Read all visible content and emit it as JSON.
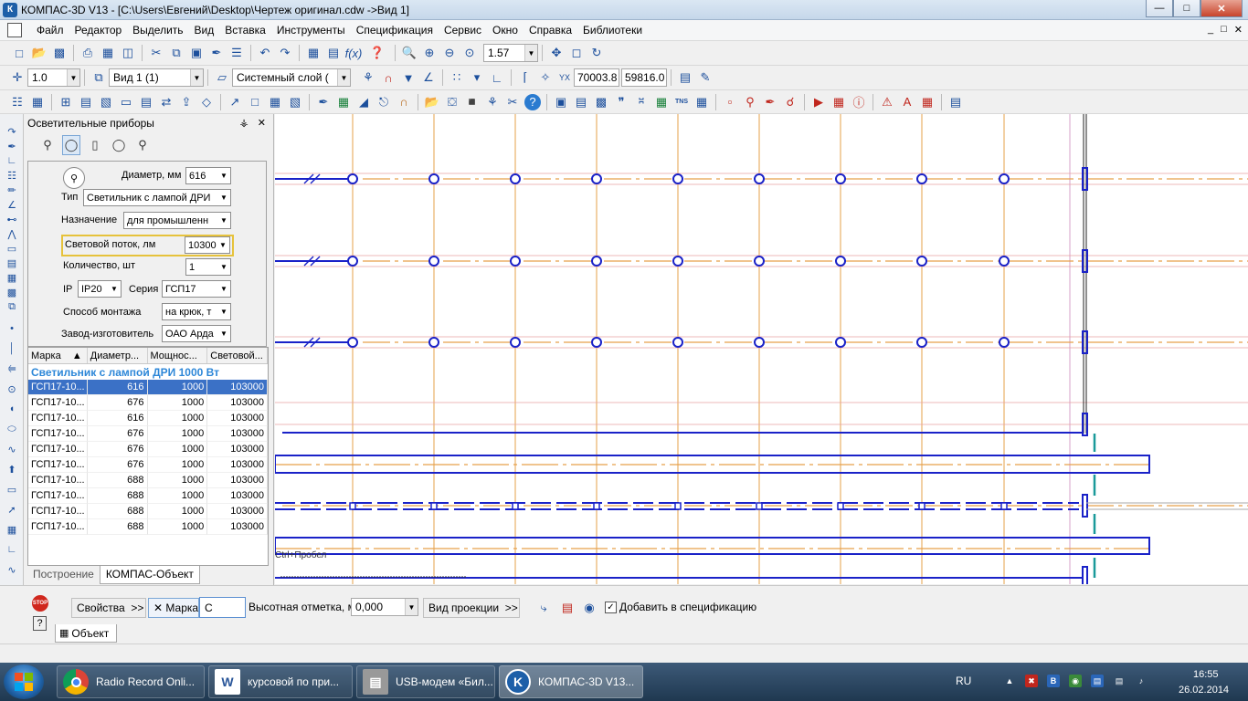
{
  "window": {
    "title": "КОМПАС-3D V13 - [C:\\Users\\Евгений\\Desktop\\Чертеж оригинал.cdw ->Вид 1]",
    "app_icon": "К"
  },
  "menu": [
    "Файл",
    "Редактор",
    "Выделить",
    "Вид",
    "Вставка",
    "Инструменты",
    "Спецификация",
    "Сервис",
    "Окно",
    "Справка",
    "Библиотеки"
  ],
  "toolbar1": {
    "zoom": "1.57"
  },
  "toolbar2": {
    "scale": "1.0",
    "view": "Вид 1 (1)",
    "layer": "Системный слой (",
    "coord_x": "70003.8",
    "coord_y": "59816.0"
  },
  "panel": {
    "title": "Осветительные приборы",
    "props": {
      "diameter_label": "Диаметр, мм",
      "diameter_value": "616",
      "type_label": "Тип",
      "type_value": "Светильник с лампой ДРИ",
      "purpose_label": "Назначение",
      "purpose_value": "для промышленн",
      "flux_label": "Световой поток, лм",
      "flux_value": "10300",
      "count_label": "Количество, шт",
      "count_value": "1",
      "ip_label": "IP",
      "ip_value": "IP20",
      "series_label": "Серия",
      "series_value": "ГСП17",
      "mount_label": "Способ монтажа",
      "mount_value": "на крюк, т",
      "maker_label": "Завод-изготовитель",
      "maker_value": "ОАО Арда"
    },
    "table": {
      "headers": [
        "Марка",
        "Диаметр...",
        "Мощнос...",
        "Световой..."
      ],
      "group": "Светильник с лампой ДРИ 1000 Вт",
      "rows": [
        {
          "mark": "ГСП17-10...",
          "diameter": "616",
          "power": "1000",
          "flux": "103000"
        },
        {
          "mark": "ГСП17-10...",
          "diameter": "676",
          "power": "1000",
          "flux": "103000"
        },
        {
          "mark": "ГСП17-10...",
          "diameter": "616",
          "power": "1000",
          "flux": "103000"
        },
        {
          "mark": "ГСП17-10...",
          "diameter": "676",
          "power": "1000",
          "flux": "103000"
        },
        {
          "mark": "ГСП17-10...",
          "diameter": "676",
          "power": "1000",
          "flux": "103000"
        },
        {
          "mark": "ГСП17-10...",
          "diameter": "676",
          "power": "1000",
          "flux": "103000"
        },
        {
          "mark": "ГСП17-10...",
          "diameter": "688",
          "power": "1000",
          "flux": "103000"
        },
        {
          "mark": "ГСП17-10...",
          "diameter": "688",
          "power": "1000",
          "flux": "103000"
        },
        {
          "mark": "ГСП17-10...",
          "diameter": "688",
          "power": "1000",
          "flux": "103000"
        },
        {
          "mark": "ГСП17-10...",
          "diameter": "688",
          "power": "1000",
          "flux": "103000"
        }
      ]
    },
    "tabs": [
      "Построение",
      "КОМПАС-Объект"
    ]
  },
  "drawing": {
    "hint": "Ctrl+Пробел"
  },
  "propbar": {
    "properties": "Свойства",
    "mark_label": "Марка",
    "mark_value": "С",
    "height_label": "Высотная отметка, м",
    "height_value": "0,000",
    "projection": "Вид проекции",
    "add_spec": "Добавить в спецификацию",
    "tab": "Объект",
    "stop": "STOP"
  },
  "taskbar": {
    "tasks": [
      "Radio Record Onli...",
      "курсовой по при...",
      "USB-модем «Бил...",
      "КОМПАС-3D V13..."
    ],
    "lang": "RU",
    "time": "16:55",
    "date": "26.02.2014"
  },
  "colors": {
    "grid_line": "#e6a04a",
    "entity": "#1a22c8",
    "selection": "#3b71c6",
    "accent_yellow": "#e6c23b"
  }
}
